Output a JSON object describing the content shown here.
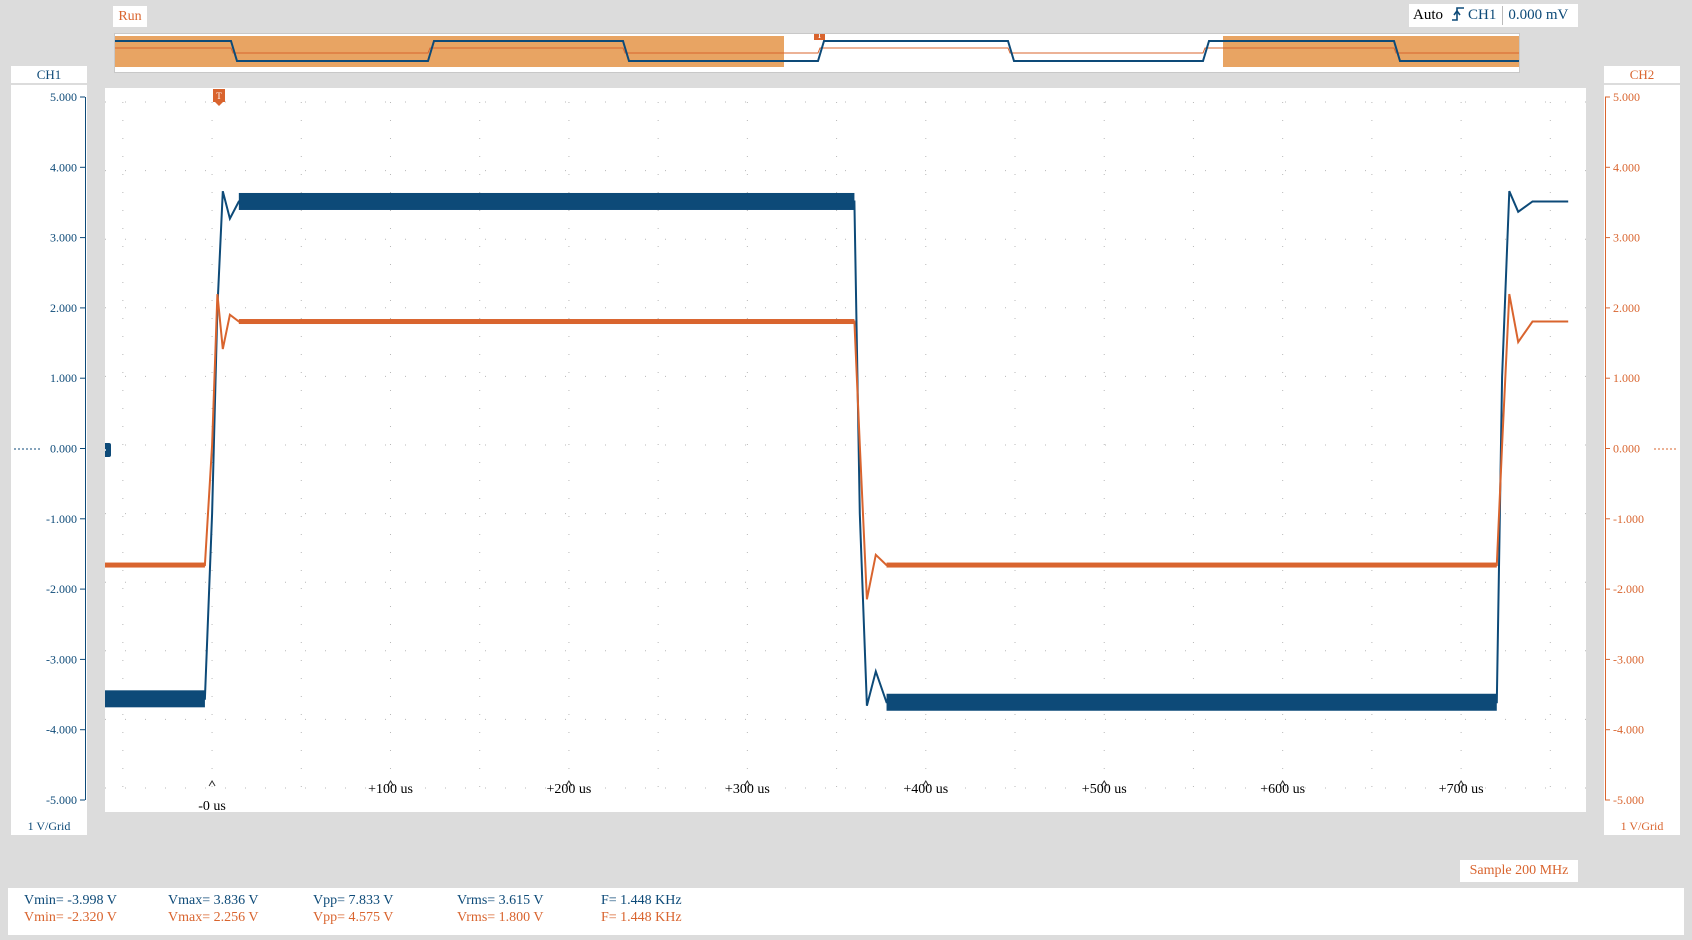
{
  "status": "Run",
  "trigger": {
    "mode": "Auto",
    "source": "CH1",
    "level": "0.000 mV",
    "edge_icon": "rising-edge-icon",
    "marker": "T"
  },
  "colors": {
    "ch1": "#0d4a78",
    "ch2": "#d9642e",
    "overview_highlight": "#e8a463"
  },
  "ch1": {
    "name": "CH1",
    "scale": "1 V/Grid"
  },
  "ch2": {
    "name": "CH2",
    "scale": "1 V/Grid"
  },
  "sample": "Sample 200 MHz",
  "measurements": {
    "ch1": {
      "vmin": "Vmin= -3.998 V",
      "vmax": "Vmax= 3.836 V",
      "vpp": "Vpp= 7.833 V",
      "vrms": "Vrms= 3.615 V",
      "freq": "F= 1.448 KHz"
    },
    "ch2": {
      "vmin": "Vmin= -2.320 V",
      "vmax": "Vmax= 2.256 V",
      "vpp": "Vpp= 4.575 V",
      "vrms": "Vrms= 1.800 V",
      "freq": "F= 1.448 KHz"
    }
  },
  "chart_data": {
    "type": "line",
    "x_ticks": [
      "-0 us",
      "+100 us",
      "+200 us",
      "+300 us",
      "+400 us",
      "+500 us",
      "+600 us",
      "+700 us"
    ],
    "y_ticks": [
      "5.000",
      "4.000",
      "3.000",
      "2.000",
      "1.000",
      "0.000",
      "-1.000",
      "-2.000",
      "-3.000",
      "-4.000",
      "-5.000"
    ],
    "xlim": [
      -60,
      770
    ],
    "ylim": [
      -5,
      5
    ],
    "series": [
      {
        "x": [
          -60,
          -4,
          0,
          3,
          6,
          10,
          15,
          360,
          363,
          367,
          372,
          378,
          720,
          723,
          727,
          732,
          740,
          760
        ],
        "y": [
          -3.7,
          -3.7,
          -1.0,
          2.0,
          3.7,
          3.3,
          3.55,
          3.55,
          -1.0,
          -3.8,
          -3.3,
          -3.75,
          -3.75,
          1.0,
          3.7,
          3.4,
          3.55,
          3.55
        ]
      },
      {
        "x": [
          -60,
          -4,
          0,
          3,
          6,
          10,
          15,
          360,
          363,
          367,
          372,
          378,
          720,
          723,
          727,
          732,
          740,
          760
        ],
        "y": [
          -1.75,
          -1.75,
          0.0,
          2.2,
          1.4,
          1.9,
          1.8,
          1.8,
          0.0,
          -2.25,
          -1.6,
          -1.75,
          -1.75,
          0.0,
          2.2,
          1.5,
          1.8,
          1.8
        ]
      }
    ]
  }
}
